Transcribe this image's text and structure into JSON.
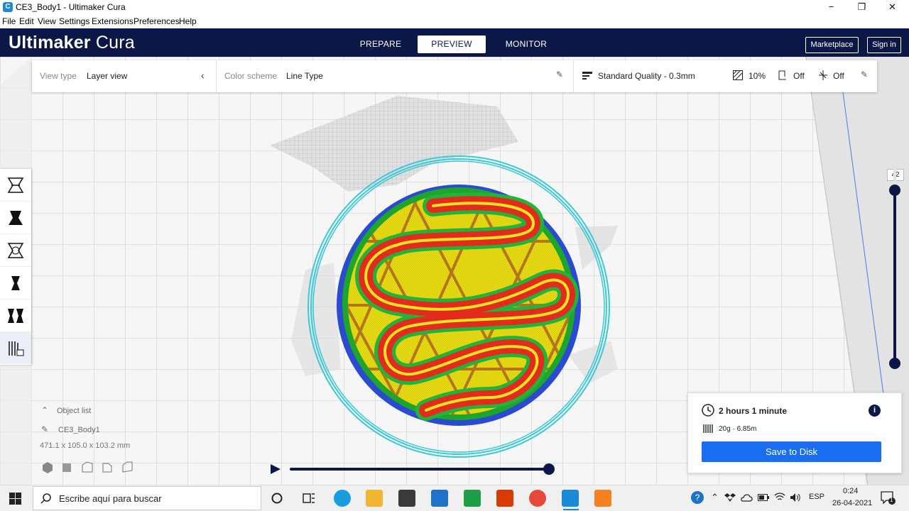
{
  "window": {
    "title": "CE3_Body1 - Ultimaker Cura",
    "app_icon": "cura-app-icon",
    "controls": [
      "−",
      "❐",
      "✕"
    ]
  },
  "menu": [
    "File",
    "Edit",
    "View",
    "Settings",
    "Extensions",
    "Preferences",
    "Help"
  ],
  "header": {
    "brand_bold": "Ultimaker",
    "brand_light": "Cura",
    "tabs": [
      {
        "label": "PREPARE",
        "active": false
      },
      {
        "label": "PREVIEW",
        "active": true
      },
      {
        "label": "MONITOR",
        "active": false
      }
    ],
    "marketplace_label": "Marketplace",
    "signin_label": "Sign in"
  },
  "stage": {
    "view_type_label": "View type",
    "view_type_value": "Layer view",
    "color_scheme_label": "Color scheme",
    "color_scheme_value": "Line Type",
    "quality": "Standard Quality - 0.3mm",
    "infill": "10%",
    "support": "Off",
    "adhesion": "Off"
  },
  "tools": [
    "move-tool-icon",
    "scale-tool-icon",
    "rotate-tool-icon",
    "mirror-tool-icon",
    "per-model-settings-icon",
    "support-blocker-icon"
  ],
  "objects": {
    "header": "Object list",
    "name": "CE3_Body1",
    "dimensions": "471.1 x 105.0 x 103.2 mm"
  },
  "layer_slider": {
    "current_layer": "42",
    "level": 1.0
  },
  "simulation": {
    "progress": 1.0
  },
  "print": {
    "time": "2 hours 1 minute",
    "material": "20g · 6.85m",
    "save_label": "Save to Disk"
  },
  "taskbar": {
    "search_placeholder": "Escribe aquí para buscar",
    "language": "ESP",
    "time": "0:24",
    "date": "26-04-2021",
    "notification_count": "1"
  },
  "colors": {
    "header_bg": "#0b1847",
    "accent": "#196ef0",
    "skirt": "#39c9d8",
    "outer_wall": "#e22b1a",
    "inner_wall": "#1ea52b",
    "skin": "#e9df12",
    "infill": "#b5751d"
  }
}
